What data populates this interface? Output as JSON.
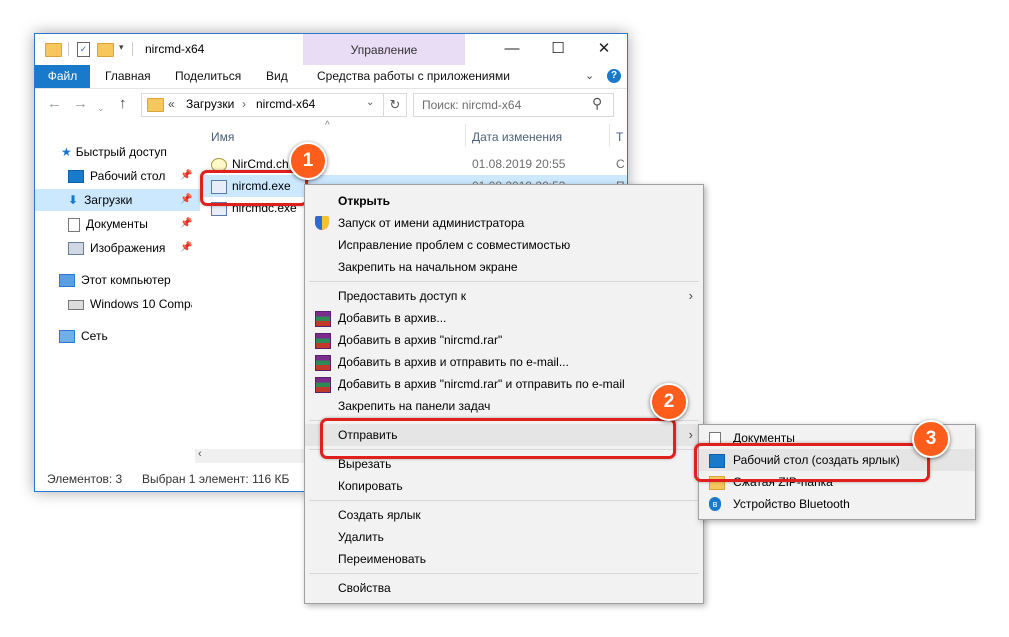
{
  "window": {
    "title": "nircmd-x64",
    "manage_tab": "Управление",
    "ribbon": {
      "file": "Файл",
      "tabs": [
        "Главная",
        "Поделиться",
        "Вид",
        "Средства работы с приложениями"
      ]
    },
    "address": {
      "chevron": "«",
      "path": [
        "Загрузки",
        "nircmd-x64"
      ]
    },
    "search_placeholder": "Поиск: nircmd-x64",
    "nav": {
      "quick_access": "Быстрый доступ",
      "items": [
        "Рабочий стол",
        "Загрузки",
        "Документы",
        "Изображения"
      ],
      "this_pc": "Этот компьютер",
      "drive": "Windows 10 Compa",
      "network": "Сеть"
    },
    "columns": {
      "name": "Имя",
      "date": "Дата изменения",
      "type": "Т"
    },
    "files": [
      {
        "name": "NirCmd.ch",
        "date": "01.08.2019 20:55",
        "type": "С"
      },
      {
        "name": "nircmd.exe",
        "date": "01.08.2019 20:53",
        "type": "П"
      },
      {
        "name": "nircmdc.exe",
        "date": "",
        "type": ""
      }
    ],
    "status": {
      "count": "Элементов: 3",
      "selected": "Выбран 1 элемент: 116 КБ"
    }
  },
  "context_menu": {
    "items": [
      {
        "label": "Открыть",
        "bold": true
      },
      {
        "label": "Запуск от имени администратора",
        "icon": "shield-icon"
      },
      {
        "label": "Исправление проблем с совместимостью"
      },
      {
        "label": "Закрепить на начальном экране"
      },
      {
        "label": "Предоставить доступ к",
        "submenu": true
      },
      {
        "label": "Добавить в архив...",
        "icon": "winrar-icon"
      },
      {
        "label": "Добавить в архив \"nircmd.rar\"",
        "icon": "winrar-icon"
      },
      {
        "label": "Добавить в архив и отправить по e-mail...",
        "icon": "winrar-icon"
      },
      {
        "label": "Добавить в архив \"nircmd.rar\" и отправить по e-mail",
        "icon": "winrar-icon"
      },
      {
        "label": "Закрепить на панели задач"
      },
      {
        "label": "Отправить",
        "submenu": true
      },
      {
        "label": "Вырезать"
      },
      {
        "label": "Копировать"
      },
      {
        "label": "Создать ярлык"
      },
      {
        "label": "Удалить"
      },
      {
        "label": "Переименовать"
      },
      {
        "label": "Свойства"
      }
    ]
  },
  "send_to_menu": {
    "items": [
      {
        "label": "Документы"
      },
      {
        "label": "Рабочий стол (создать ярлык)"
      },
      {
        "label": "Сжатая ZIP-папка"
      },
      {
        "label": "Устройство Bluetooth"
      }
    ]
  },
  "badges": [
    "1",
    "2",
    "3"
  ],
  "colors": {
    "accent": "#1979ca",
    "highlight": "#e0201c",
    "badge": "#ff5d1c",
    "manage_tab": "#e9dcf5"
  }
}
